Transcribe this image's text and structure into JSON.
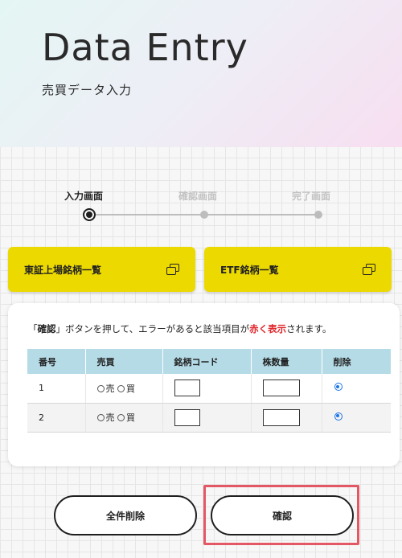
{
  "hero": {
    "title": "Data Entry",
    "subtitle": "売買データ入力"
  },
  "steps": [
    {
      "label": "入力画面",
      "active": true
    },
    {
      "label": "確認画面",
      "active": false
    },
    {
      "label": "完了画面",
      "active": false
    }
  ],
  "links": {
    "tse_list": "東証上場銘柄一覧",
    "etf_list": "ETF銘柄一覧",
    "icon": "external-window-icon"
  },
  "note": {
    "q1": "「",
    "kw": "確認",
    "q2": "」",
    "text1": "ボタンを押して、エラーがあると該当項目が",
    "red": "赤く表示",
    "text2": "されます。",
    "red_color": "#e0252a"
  },
  "table": {
    "headers": [
      "番号",
      "売買",
      "銘柄コード",
      "株数量",
      "削除"
    ],
    "rows": [
      {
        "num": "1",
        "sell": "売",
        "buy": "買",
        "code": "",
        "qty": "",
        "delete_checked": true
      },
      {
        "num": "2",
        "sell": "売",
        "buy": "買",
        "code": "",
        "qty": "",
        "delete_checked": true
      }
    ]
  },
  "buttons": {
    "delete_all": "全件削除",
    "confirm": "確認"
  },
  "colors": {
    "accent_yellow": "#ecd900",
    "header_blue": "#b5dbe6",
    "highlight": "#e45865",
    "radio_blue": "#1a73e8"
  }
}
